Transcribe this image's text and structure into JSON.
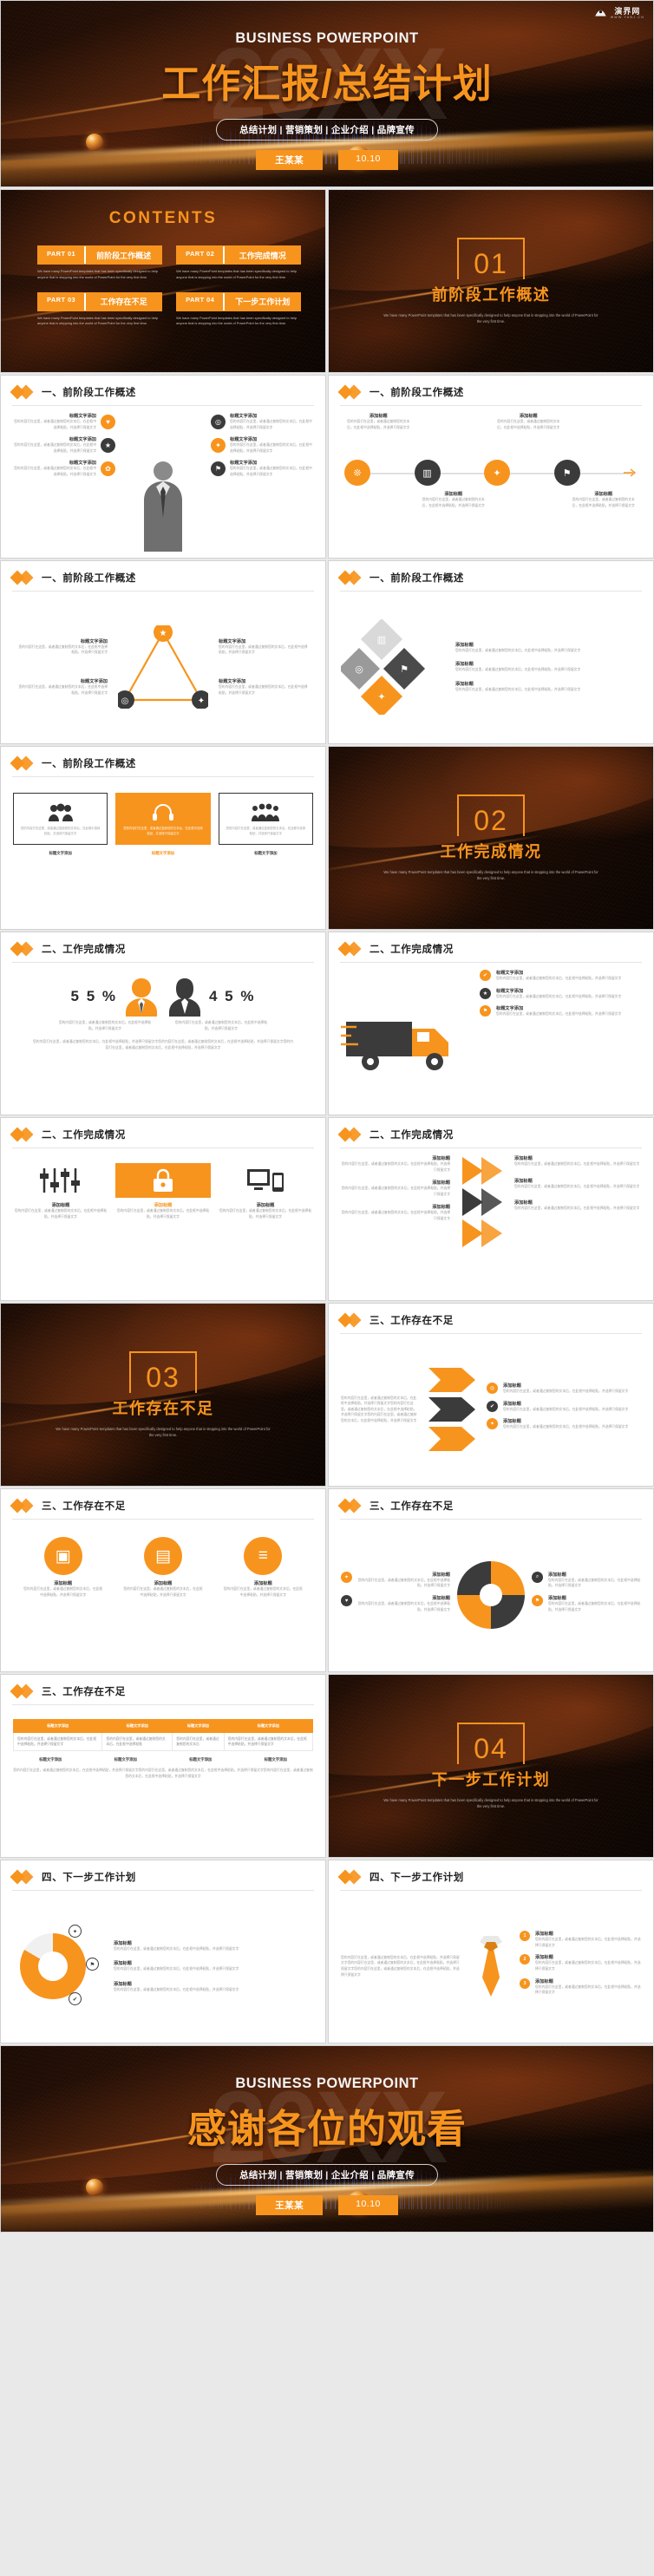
{
  "brand": {
    "accent": "#f7941e",
    "dark": "#3b3b3b",
    "logo_text": "演界网",
    "logo_sub": "WWW.YANJ.CN",
    "ghost_year": "20XX"
  },
  "title_slide": {
    "eyebrow": "BUSINESS POWERPOINT",
    "title": "工作汇报/总结计划",
    "pill": "总结计划 | 营销策划 | 企业介绍 | 品牌宣传",
    "author": "王某某",
    "date": "10.10"
  },
  "contents": {
    "heading": "CONTENTS",
    "desc": "We have many PowerPoint templates that has been specifically designed to help anyone that is stepping into the world of PowerPoint for the very first time.",
    "items": [
      {
        "part": "PART 01",
        "name": "前阶段工作概述"
      },
      {
        "part": "PART 02",
        "name": "工作完成情况"
      },
      {
        "part": "PART 03",
        "name": "工作存在不足"
      },
      {
        "part": "PART 04",
        "name": "下一步工作计划"
      }
    ]
  },
  "sections": [
    {
      "num": "01",
      "title": "前阶段工作概述"
    },
    {
      "num": "02",
      "title": "工作完成情况"
    },
    {
      "num": "03",
      "title": "工作存在不足"
    },
    {
      "num": "04",
      "title": "下一步工作计划"
    }
  ],
  "section_desc": "We have many PowerPoint templates that has been specifically designed to help anyone that is stepping into the world of PowerPoint for the very first time.",
  "headers": {
    "h1": "一、前阶段工作概述",
    "h2": "二、工作完成情况",
    "h3": "三、工作存在不足",
    "h4": "四、下一步工作计划"
  },
  "common": {
    "item_title": "标题文字添加",
    "body_short": "您的内容打在这里，或者通过复制您的文本后，在此框中选择粘贴，并选择只保留文字",
    "body_long": "您的内容打在这里，或者通过复制您的文本后，在此框中选择粘贴，并选择只保留文字您的内容打在这里，或者通过复制您的文本后，在此框中选择粘贴，并选择只保留文字您的内容打在这里，或者通过复制您的文本后，在此框中选择粘贴，并选择只保留文字",
    "add_title": "添加标题"
  },
  "slide_people": {
    "left_pct": "5 5 %",
    "right_pct": "4 5 %"
  },
  "table_slide": {
    "headers": [
      "标题文字添加",
      "标题文字添加",
      "标题文字添加",
      "标题文字添加"
    ],
    "rows": [
      [
        "您的内容打在这里，或者通过复制您的文本后，在此框中选择粘贴，并选择只保留文字",
        "您的内容打在这里，或者通过复制您的文本后，在此框中选择粘贴",
        "您的内容打在这里，或者通过复制您的文本后",
        "您的内容打在这里，或者通过复制您的文本后，在此框中选择粘贴，并选择只保留文字"
      ]
    ],
    "labels": [
      "标题文字添加",
      "标题文字添加",
      "标题文字添加",
      "标题文字添加"
    ]
  },
  "thanks_slide": {
    "eyebrow": "BUSINESS POWERPOINT",
    "title": "感谢各位的观看",
    "pill": "总结计划 | 营销策划 | 企业介绍 | 品牌宣传",
    "author": "王某某",
    "date": "10.10"
  },
  "icons": {
    "heart": "♥",
    "star": "★",
    "gear": "✿",
    "bulb": "✦",
    "check": "✔",
    "chart": "▥",
    "people": "❊",
    "lock": "🔒",
    "target": "◎",
    "flag": "⚑",
    "search": "⌕",
    "arrow": "➤",
    "camera": "▣",
    "monitor": "▤",
    "slider": "≡"
  }
}
